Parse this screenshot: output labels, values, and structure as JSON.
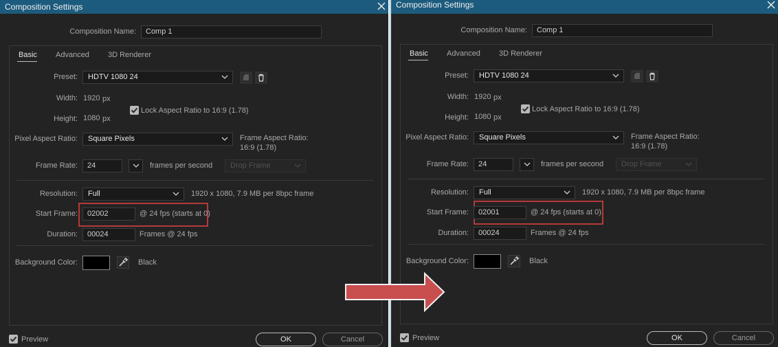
{
  "dialogs": [
    {
      "title": "Composition Settings",
      "composition_name_label": "Composition Name:",
      "composition_name": "Comp 1",
      "tabs": [
        "Basic",
        "Advanced",
        "3D Renderer"
      ],
      "preset_label": "Preset:",
      "preset": "HDTV 1080 24",
      "width_label": "Width:",
      "width": "1920",
      "height_label": "Height:",
      "height": "1080",
      "px": "px",
      "lock_aspect": "Lock Aspect Ratio to 16:9 (1.78)",
      "pixel_aspect_label": "Pixel Aspect Ratio:",
      "pixel_aspect": "Square Pixels",
      "frame_aspect_label": "Frame Aspect Ratio:",
      "frame_aspect": "16:9 (1.78)",
      "frame_rate_label": "Frame Rate:",
      "frame_rate": "24",
      "fps_text": "frames per second",
      "drop_frame": "Drop Frame",
      "resolution_label": "Resolution:",
      "resolution": "Full",
      "resolution_info": "1920 x 1080, 7.9 MB per 8bpc frame",
      "start_frame_label": "Start Frame:",
      "start_frame": "02002",
      "start_frame_info": "@ 24 fps (starts at 0)",
      "duration_label": "Duration:",
      "duration": "00024",
      "duration_info": "Frames @ 24 fps",
      "bg_label": "Background Color:",
      "bg_name": "Black",
      "bg_color": "#000000",
      "preview": "Preview",
      "ok": "OK",
      "cancel": "Cancel"
    },
    {
      "title": "Composition Settings",
      "composition_name_label": "Composition Name:",
      "composition_name": "Comp 1",
      "tabs": [
        "Basic",
        "Advanced",
        "3D Renderer"
      ],
      "preset_label": "Preset:",
      "preset": "HDTV 1080 24",
      "width_label": "Width:",
      "width": "1920",
      "height_label": "Height:",
      "height": "1080",
      "px": "px",
      "lock_aspect": "Lock Aspect Ratio to 16:9 (1.78)",
      "pixel_aspect_label": "Pixel Aspect Ratio:",
      "pixel_aspect": "Square Pixels",
      "frame_aspect_label": "Frame Aspect Ratio:",
      "frame_aspect": "16:9 (1.78)",
      "frame_rate_label": "Frame Rate:",
      "frame_rate": "24",
      "fps_text": "frames per second",
      "drop_frame": "Drop Frame",
      "resolution_label": "Resolution:",
      "resolution": "Full",
      "resolution_info": "1920 x 1080, 7.9 MB per 8bpc frame",
      "start_frame_label": "Start Frame:",
      "start_frame": "02001",
      "start_frame_info": "@ 24 fps (starts at 0)",
      "duration_label": "Duration:",
      "duration": "00024",
      "duration_info": "Frames @ 24 fps",
      "bg_label": "Background Color:",
      "bg_name": "Black",
      "bg_color": "#000000",
      "preview": "Preview",
      "ok": "OK",
      "cancel": "Cancel"
    }
  ],
  "colors": {
    "titlebar": "#1c5b7d",
    "panel_bg": "#232323",
    "highlight": "#b53a3a",
    "arrow": "#c94e4e",
    "value_blue": "#3d8fd6"
  },
  "arrow_icon": "right-arrow-icon"
}
